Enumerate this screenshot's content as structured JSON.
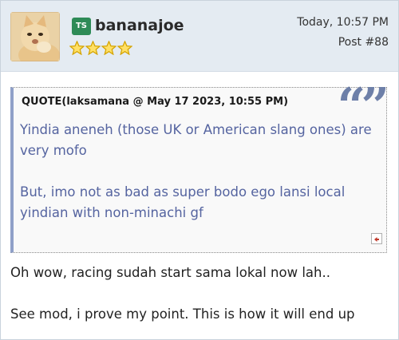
{
  "post": {
    "username": "bananajoe",
    "badge": "TS",
    "rank_stars": 4,
    "timestamp": "Today, 10:57 PM",
    "post_number": "Post #88"
  },
  "quote": {
    "header": "QUOTE(laksamana @ May 17 2023, 10:55 PM)",
    "mark": "“”",
    "paragraphs": [
      "Yindia aneneh (those UK or American slang ones) are very mofo",
      "But, imo not as bad as super bodo ego lansi local yindian with non-minachi gf"
    ]
  },
  "body": {
    "paragraphs": [
      "Oh wow, racing sudah start sama lokal now lah..",
      "See mod, i prove my point. This is how it will end up"
    ]
  },
  "colors": {
    "header_bg": "#e4ebf2",
    "badge_bg": "#2e8b57",
    "quote_text": "#5564a0",
    "quote_border": "#8fa0c8",
    "star_fill": "#f5c518"
  },
  "icons": {
    "avatar": "cat-avatar",
    "rank": "star-icon",
    "quote_jump": "arrow-jump-icon"
  }
}
